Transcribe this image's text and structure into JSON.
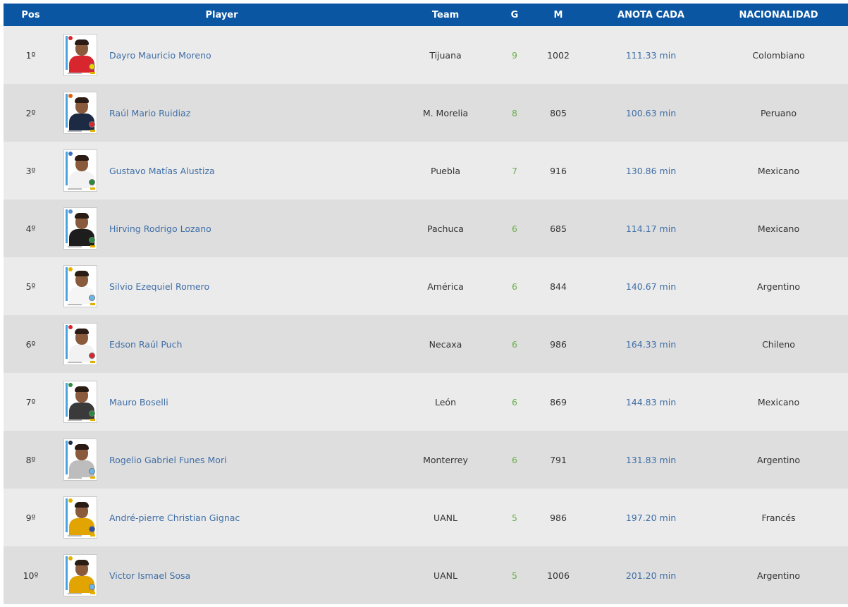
{
  "headers": {
    "pos": "Pos",
    "player": "Player",
    "team": "Team",
    "g": "G",
    "m": "M",
    "anota": "ANOTA CADA",
    "nac": "NACIONALIDAD"
  },
  "colors": {
    "header_bg": "#0b56a2",
    "link": "#3f6ea6",
    "goals": "#6ab04c",
    "row_odd": "#ebebeb",
    "row_even": "#dedede"
  },
  "rows": [
    {
      "pos": "1º",
      "player": "Dayro Mauricio Moreno",
      "team": "Tijuana",
      "g": "9",
      "m": "1002",
      "anota": "111.33 min",
      "nac": "Colombiano",
      "icon": "player-photo-icon"
    },
    {
      "pos": "2º",
      "player": "Raúl Mario Ruidiaz",
      "team": "M. Morelia",
      "g": "8",
      "m": "805",
      "anota": "100.63 min",
      "nac": "Peruano",
      "icon": "player-photo-icon"
    },
    {
      "pos": "3º",
      "player": "Gustavo Matías Alustiza",
      "team": "Puebla",
      "g": "7",
      "m": "916",
      "anota": "130.86 min",
      "nac": "Mexicano",
      "icon": "player-photo-icon"
    },
    {
      "pos": "4º",
      "player": "Hirving Rodrigo Lozano",
      "team": "Pachuca",
      "g": "6",
      "m": "685",
      "anota": "114.17 min",
      "nac": "Mexicano",
      "icon": "player-photo-icon"
    },
    {
      "pos": "5º",
      "player": "Silvio Ezequiel Romero",
      "team": "América",
      "g": "6",
      "m": "844",
      "anota": "140.67 min",
      "nac": "Argentino",
      "icon": "player-photo-icon"
    },
    {
      "pos": "6º",
      "player": "Edson Raúl Puch",
      "team": "Necaxa",
      "g": "6",
      "m": "986",
      "anota": "164.33 min",
      "nac": "Chileno",
      "icon": "player-photo-icon"
    },
    {
      "pos": "7º",
      "player": "Mauro Boselli",
      "team": "León",
      "g": "6",
      "m": "869",
      "anota": "144.83 min",
      "nac": "Mexicano",
      "icon": "player-photo-icon"
    },
    {
      "pos": "8º",
      "player": "Rogelio Gabriel Funes Mori",
      "team": "Monterrey",
      "g": "6",
      "m": "791",
      "anota": "131.83 min",
      "nac": "Argentino",
      "icon": "player-photo-icon"
    },
    {
      "pos": "9º",
      "player": "André-pierre Christian Gignac",
      "team": "UANL",
      "g": "5",
      "m": "986",
      "anota": "197.20 min",
      "nac": "Francés",
      "icon": "player-photo-icon"
    },
    {
      "pos": "10º",
      "player": "Victor Ismael Sosa",
      "team": "UANL",
      "g": "5",
      "m": "1006",
      "anota": "201.20 min",
      "nac": "Argentino",
      "icon": "player-photo-icon"
    }
  ]
}
